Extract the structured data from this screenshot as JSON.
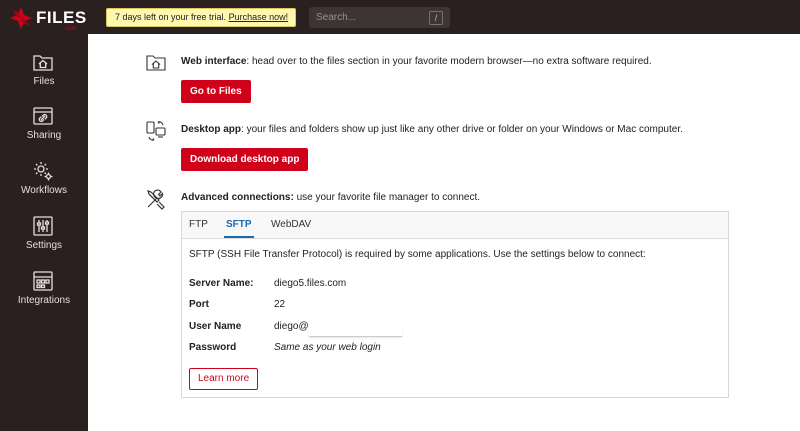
{
  "brand": {
    "name": "FILES",
    "sub": "com"
  },
  "trial_banner": {
    "text": "7 days left on your free trial.",
    "link": "Purchase now!"
  },
  "search": {
    "placeholder": "Search...",
    "shortcut": "/"
  },
  "sidebar": {
    "items": [
      {
        "label": "Files",
        "icon": "files-icon"
      },
      {
        "label": "Sharing",
        "icon": "sharing-icon"
      },
      {
        "label": "Workflows",
        "icon": "workflows-icon"
      },
      {
        "label": "Settings",
        "icon": "settings-icon"
      },
      {
        "label": "Integrations",
        "icon": "integrations-icon"
      }
    ]
  },
  "web": {
    "title": "Web interface",
    "text": ": head over to the files section in your favorite modern browser—no extra software required.",
    "button": "Go to Files"
  },
  "desktop": {
    "title": "Desktop app",
    "text": ": your files and folders show up just like any other drive or folder on your Windows or Mac computer.",
    "button": "Download desktop app"
  },
  "advanced": {
    "title": "Advanced connections:",
    "text": " use your favorite file manager to connect.",
    "tabs": [
      "FTP",
      "SFTP",
      "WebDAV"
    ],
    "active_tab": "SFTP",
    "description": "SFTP (SSH File Transfer Protocol) is required by some applications. Use the settings below to connect:",
    "fields": [
      {
        "key": "Server Name:",
        "value": "diego5.files.com"
      },
      {
        "key": "Port",
        "value": "22"
      },
      {
        "key": "User Name",
        "value": "diego@"
      },
      {
        "key": "Password",
        "value": "Same as your web login"
      }
    ],
    "learn_more": "Learn more"
  },
  "colors": {
    "accent": "#d0021b",
    "sidebar": "#2a2020",
    "link": "#1a6ab0"
  }
}
